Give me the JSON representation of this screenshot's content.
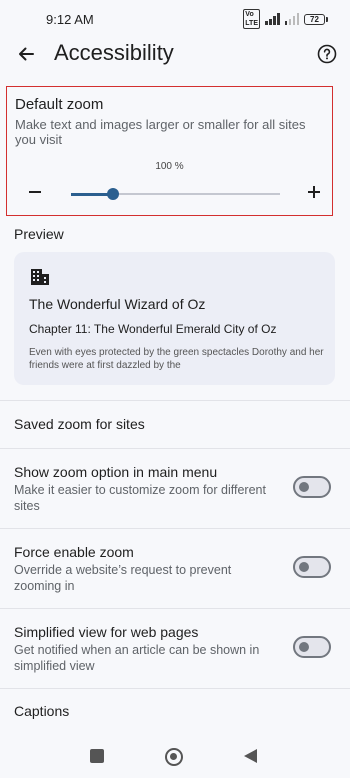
{
  "status_bar": {
    "time": "9:12 AM",
    "network_badge": "Vo LTE",
    "battery": "72"
  },
  "app_bar": {
    "title": "Accessibility",
    "back_icon": "arrow-back-icon",
    "help_icon": "help-circle-icon"
  },
  "default_zoom": {
    "title": "Default zoom",
    "description": "Make text and images larger or smaller for all sites you visit",
    "value_label": "100 %",
    "slider_fraction": 0.2,
    "highlight_color": "#d32f2f",
    "accent_color": "#2b5f8f"
  },
  "preview": {
    "label": "Preview",
    "icon": "building-icon",
    "book_title": "The Wonderful Wizard of Oz",
    "chapter": "Chapter 11: The Wonderful Emerald City of Oz",
    "excerpt": "Even with eyes protected by the green spectacles Dorothy and her friends were at first dazzled by the"
  },
  "settings": {
    "saved_zoom": {
      "title": "Saved zoom for sites"
    },
    "show_zoom": {
      "title": "Show zoom option in main menu",
      "description": "Make it easier to customize zoom for different sites",
      "enabled": false
    },
    "force_zoom": {
      "title": "Force enable zoom",
      "description": "Override a website’s request to prevent zooming in",
      "enabled": false
    },
    "simplified_view": {
      "title": "Simplified view for web pages",
      "description": "Get notified when an article can be shown in simplified view",
      "enabled": false
    },
    "captions": {
      "title": "Captions"
    }
  },
  "nav_bar": {
    "recents_icon": "square-icon",
    "home_icon": "home-circle-icon",
    "back_icon": "triangle-back-icon"
  }
}
